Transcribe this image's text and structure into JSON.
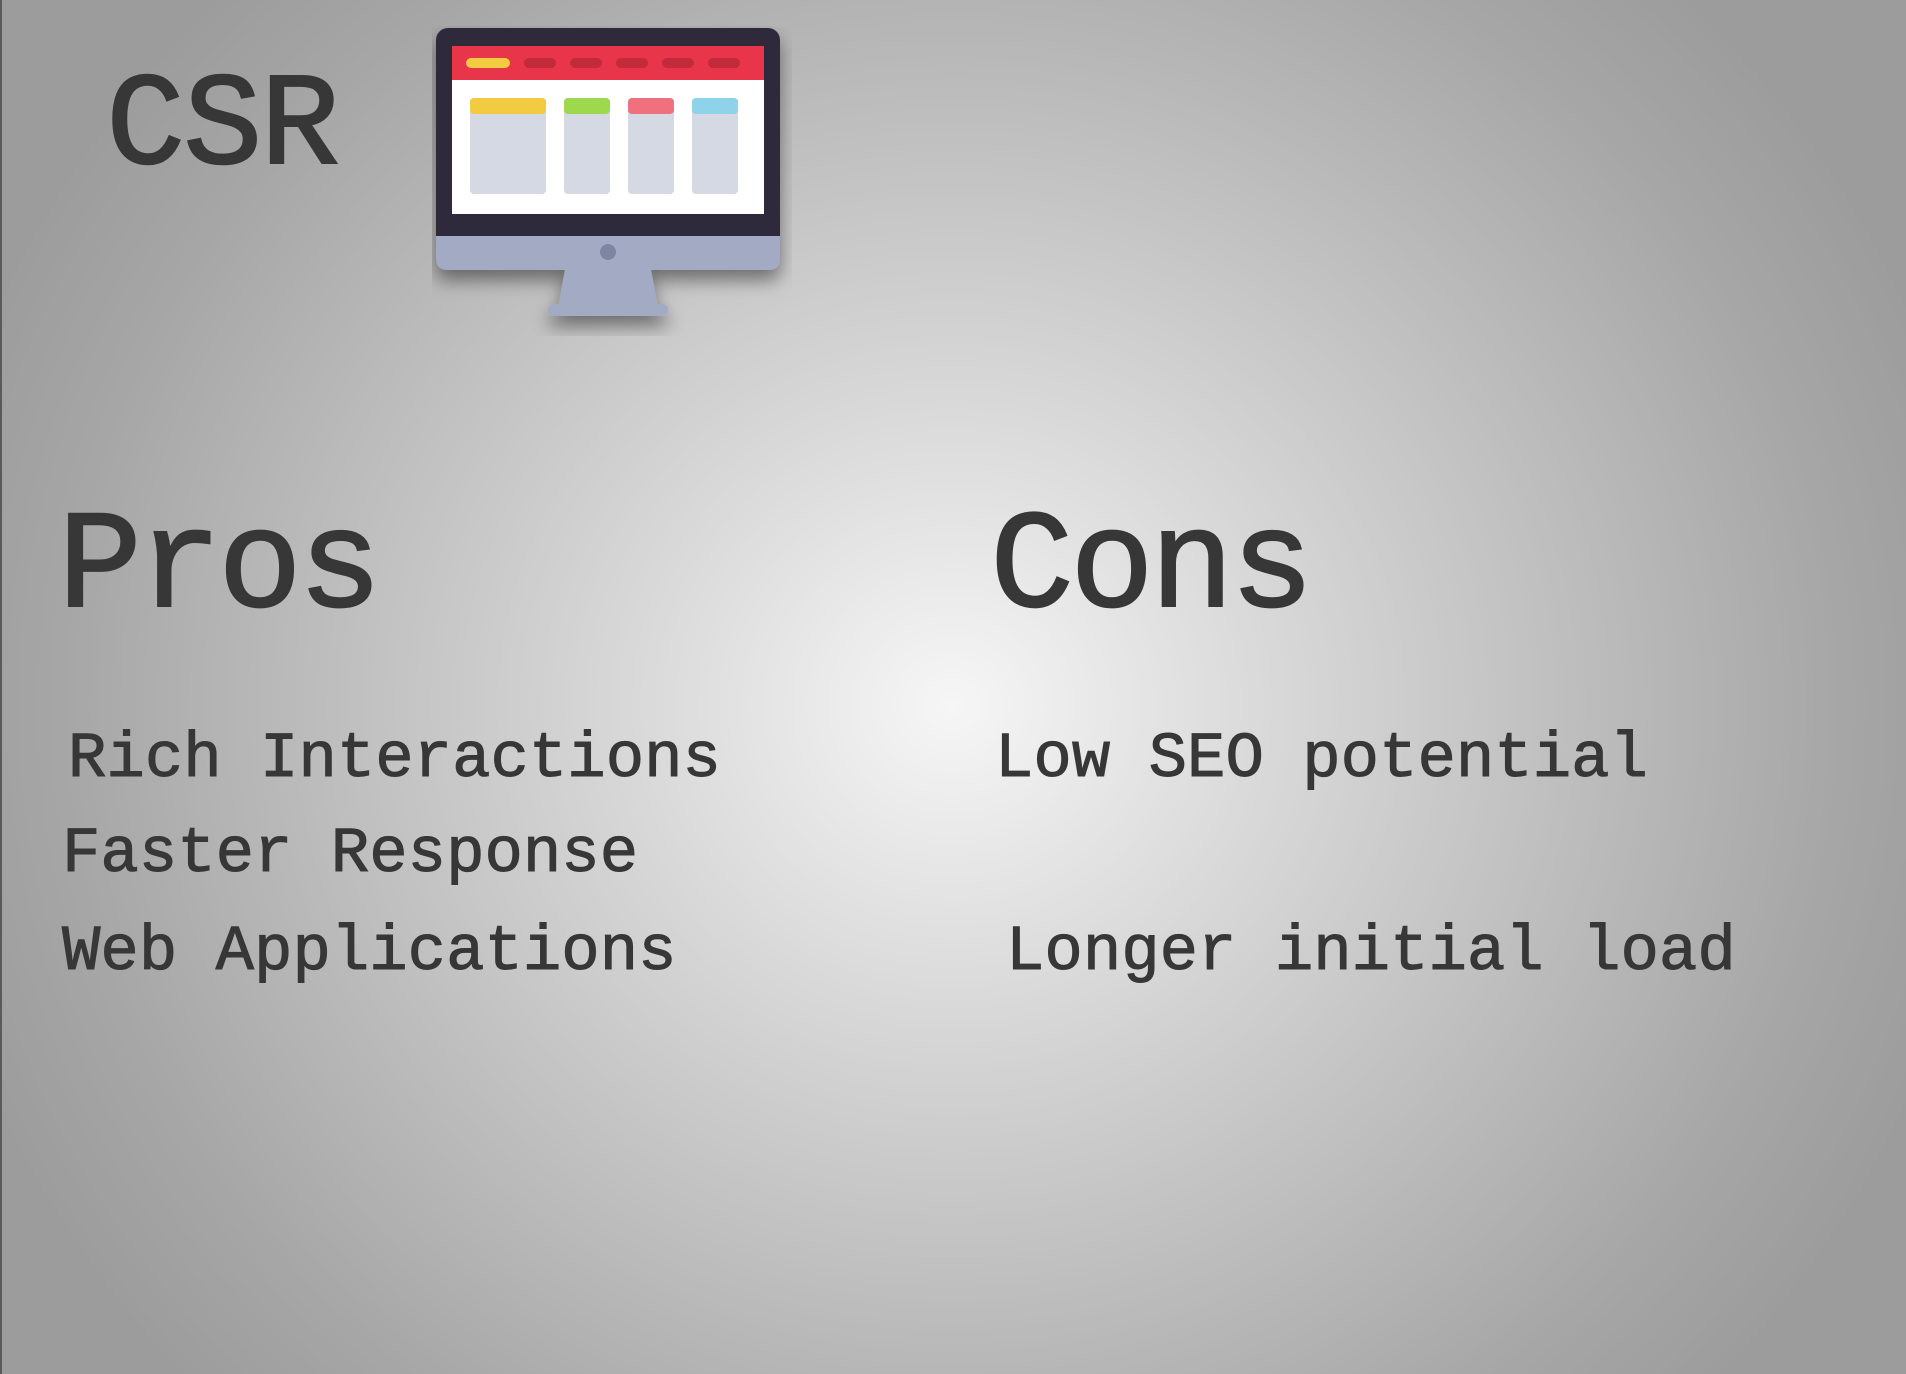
{
  "title": "CSR",
  "pros": {
    "heading": "Pros",
    "items": [
      "Rich Interactions",
      "Faster Response",
      "Web Applications"
    ]
  },
  "cons": {
    "heading": "Cons",
    "items": [
      "Low SEO potential",
      "Longer initial load"
    ]
  },
  "icon": "desktop-monitor-icon",
  "colors": {
    "text": "#373737",
    "monitor_frame": "#2e2b3a",
    "monitor_stand": "#a3abc4",
    "screen_header": "#e8364a",
    "accent_yellow": "#f2cb3f",
    "accent_green": "#9ed84e",
    "accent_pink": "#f06f7e",
    "accent_blue": "#8fd3ea",
    "card": "#d5d9e4"
  }
}
